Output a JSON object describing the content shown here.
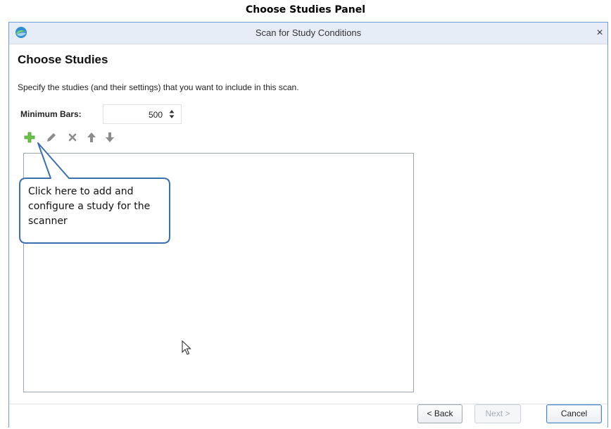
{
  "caption": "Choose Studies Panel",
  "window": {
    "title": "Scan for Study Conditions",
    "close_glyph": "×",
    "icon": "app-logo-icon"
  },
  "page": {
    "heading": "Choose Studies",
    "description": "Specify the studies (and their settings) that you want to include in this scan."
  },
  "minimum_bars": {
    "label": "Minimum Bars:",
    "value": "500"
  },
  "toolbar": {
    "icons": [
      "add-icon",
      "edit-icon",
      "delete-icon",
      "move-up-icon",
      "move-down-icon"
    ],
    "add_color": "#6cc24a",
    "inactive_color": "#8c8c8c"
  },
  "callout": {
    "text": "Click here to add and configure a study for the scanner"
  },
  "footer": {
    "back_label": "< Back",
    "next_label": "Next >",
    "cancel_label": "Cancel"
  },
  "colors": {
    "window_border": "#6e9fd6",
    "callout_border": "#3a6fb0"
  }
}
